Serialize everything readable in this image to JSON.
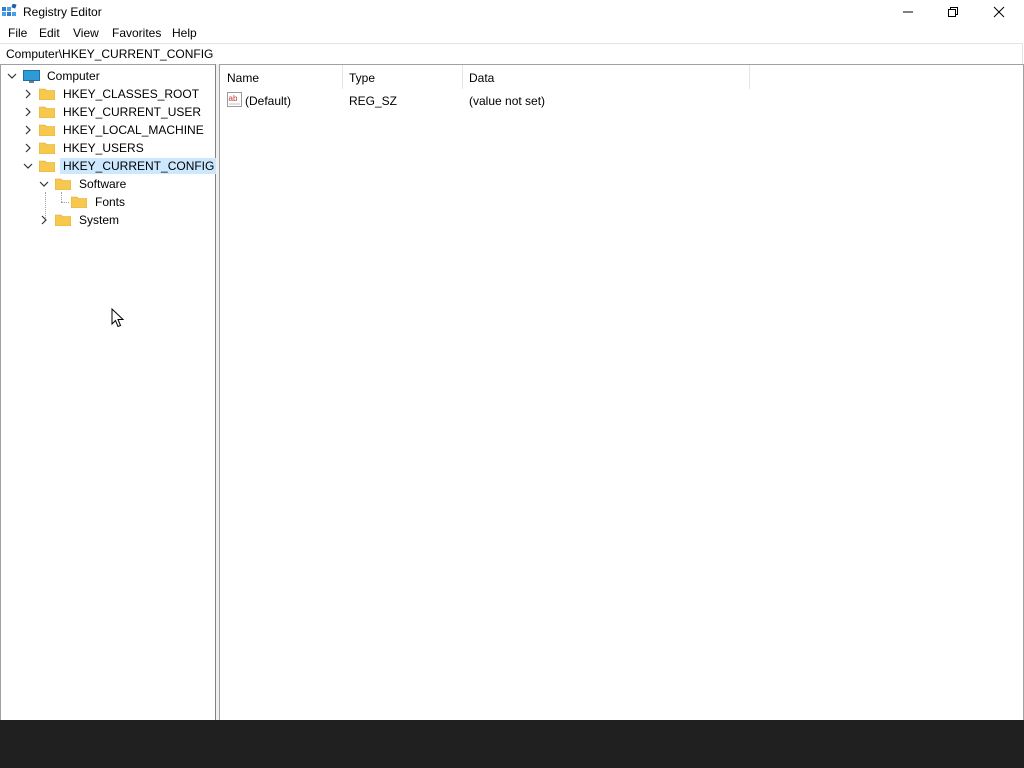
{
  "window": {
    "title": "Registry Editor"
  },
  "menu": [
    "File",
    "Edit",
    "View",
    "Favorites",
    "Help"
  ],
  "address": "Computer\\HKEY_CURRENT_CONFIG",
  "tree": {
    "root": "Computer",
    "hives": [
      "HKEY_CLASSES_ROOT",
      "HKEY_CURRENT_USER",
      "HKEY_LOCAL_MACHINE",
      "HKEY_USERS",
      "HKEY_CURRENT_CONFIG"
    ],
    "selected": "HKEY_CURRENT_CONFIG",
    "children": {
      "software": "Software",
      "fonts": "Fonts",
      "system": "System"
    }
  },
  "list": {
    "columns": [
      "Name",
      "Type",
      "Data"
    ],
    "rows": [
      {
        "name": "(Default)",
        "type": "REG_SZ",
        "data": "(value not set)",
        "icon": "string-value-icon"
      }
    ]
  },
  "colors": {
    "folder": "#f6c94e",
    "selection": "#cce8ff",
    "taskbar": "#202020"
  }
}
